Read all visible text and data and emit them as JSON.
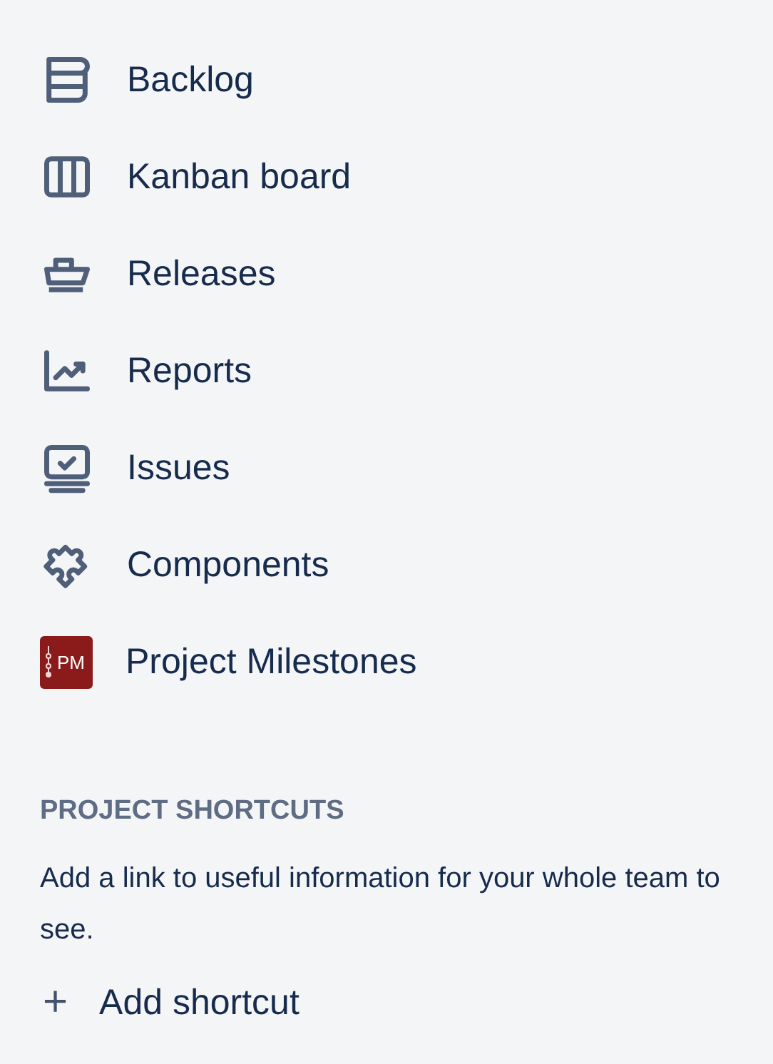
{
  "nav_items": [
    {
      "kind": "backlog",
      "label": "Backlog"
    },
    {
      "kind": "board",
      "label": "Kanban board"
    },
    {
      "kind": "releases",
      "label": "Releases"
    },
    {
      "kind": "reports",
      "label": "Reports"
    },
    {
      "kind": "issues",
      "label": "Issues"
    },
    {
      "kind": "components",
      "label": "Components"
    },
    {
      "kind": "app",
      "label": "Project Milestones",
      "logo_text": "PM"
    }
  ],
  "shortcuts": {
    "heading": "PROJECT SHORTCUTS",
    "description": "Add a link to useful information for your whole team to see.",
    "add_icon": "+",
    "add_label": "Add shortcut"
  }
}
